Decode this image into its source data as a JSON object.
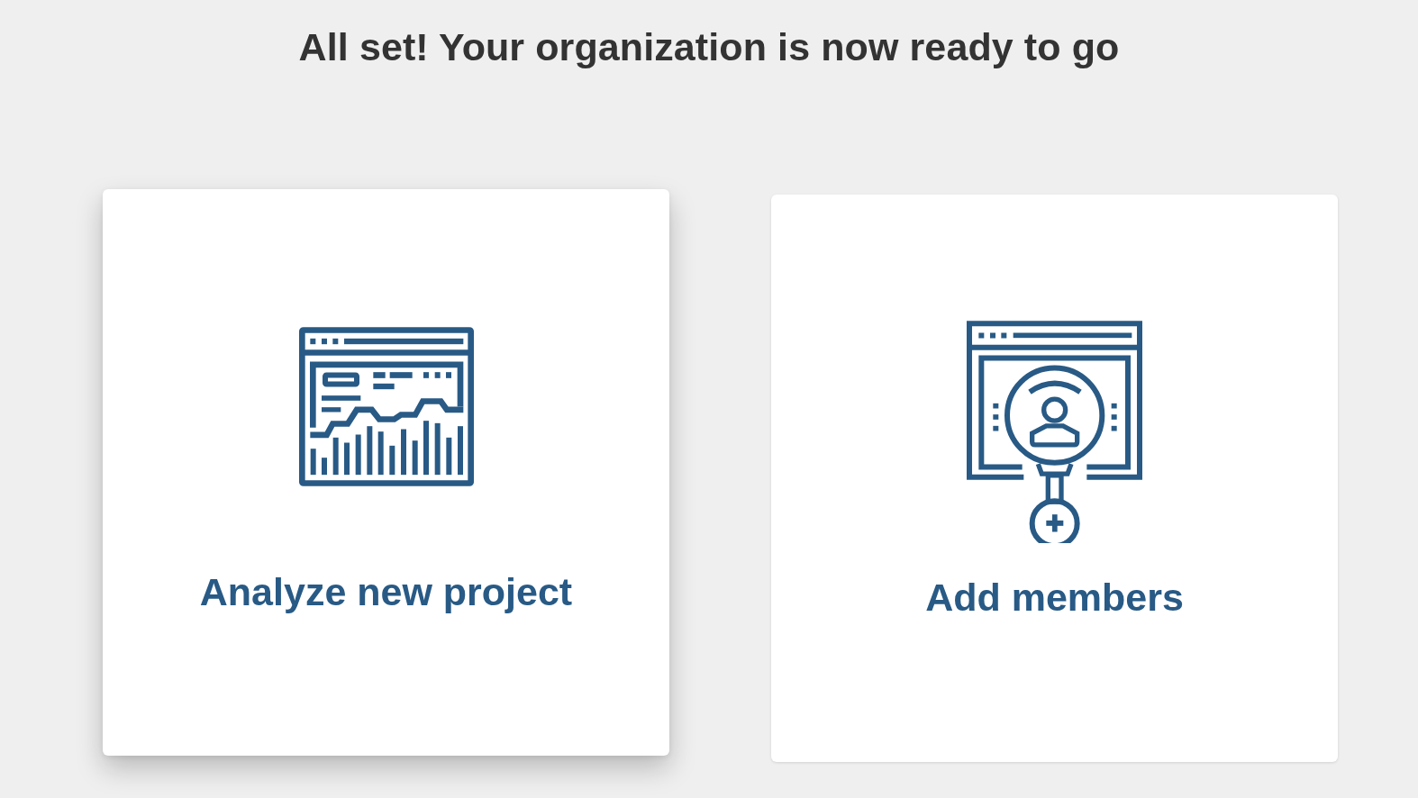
{
  "heading": "All set! Your organization is now ready to go",
  "cards": [
    {
      "kind": "chart",
      "label": "Analyze new project",
      "hovered": true
    },
    {
      "kind": "member",
      "label": "Add members",
      "hovered": false
    }
  ]
}
